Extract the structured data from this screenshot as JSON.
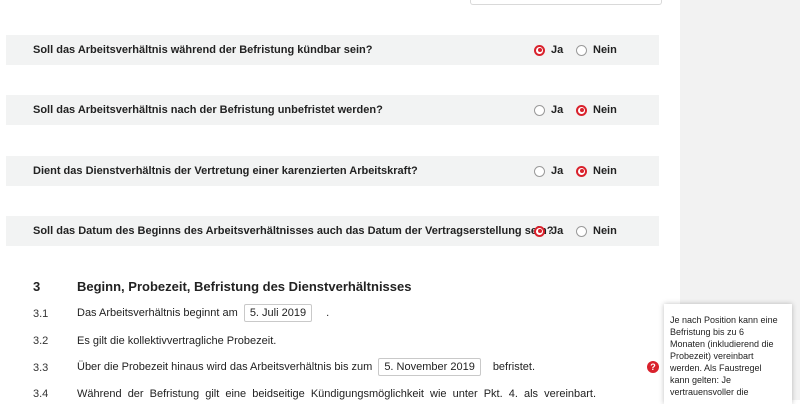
{
  "questions": [
    {
      "text": "Soll das Arbeitsverhältnis während der Befristung kündbar sein?",
      "yes_label": "Ja",
      "no_label": "Nein",
      "selected": "ja"
    },
    {
      "text": "Soll das Arbeitsverhältnis nach der Befristung unbefristet werden?",
      "yes_label": "Ja",
      "no_label": "Nein",
      "selected": "nein"
    },
    {
      "text": "Dient das Dienstverhältnis der Vertretung einer karenzierten Arbeitskraft?",
      "yes_label": "Ja",
      "no_label": "Nein",
      "selected": "nein"
    },
    {
      "text": "Soll das Datum des Beginns des Arbeitsverhältnisses auch das Datum der Vertragserstellung sein?",
      "yes_label": "Ja",
      "no_label": "Nein",
      "selected": "ja"
    }
  ],
  "section": {
    "number": "3",
    "title": "Beginn, Probezeit, Befristung des Dienstverhältnisses",
    "items": [
      {
        "number": "3.1",
        "before": "Das Arbeitsverhältnis beginnt am",
        "field": "5. Juli 2019",
        "after": "."
      },
      {
        "number": "3.2",
        "text": "Es gilt die kollektivvertragliche Probezeit."
      },
      {
        "number": "3.3",
        "before": "Über die Probezeit hinaus wird das Arbeitsverhältnis bis zum",
        "field": "5. November 2019",
        "after": "befristet."
      },
      {
        "number": "3.4",
        "text": "Während der Befristung gilt eine beidseitige Kündigungsmöglichkeit wie unter Pkt. 4. als vereinbart."
      }
    ]
  },
  "help_icon": "?",
  "tooltip_lines": [
    "Je nach Position kann eine",
    "Befristung bis zu 6",
    "Monaten (inkludierend die",
    "Probezeit) vereinbart",
    "werden. Als Faustregel",
    "kann gelten: Je",
    "vertrauensvoller die"
  ],
  "colors": {
    "accent": "#d9212c",
    "row_bg": "#f2f3f3",
    "sidebar_bg": "#f2f2f2"
  }
}
